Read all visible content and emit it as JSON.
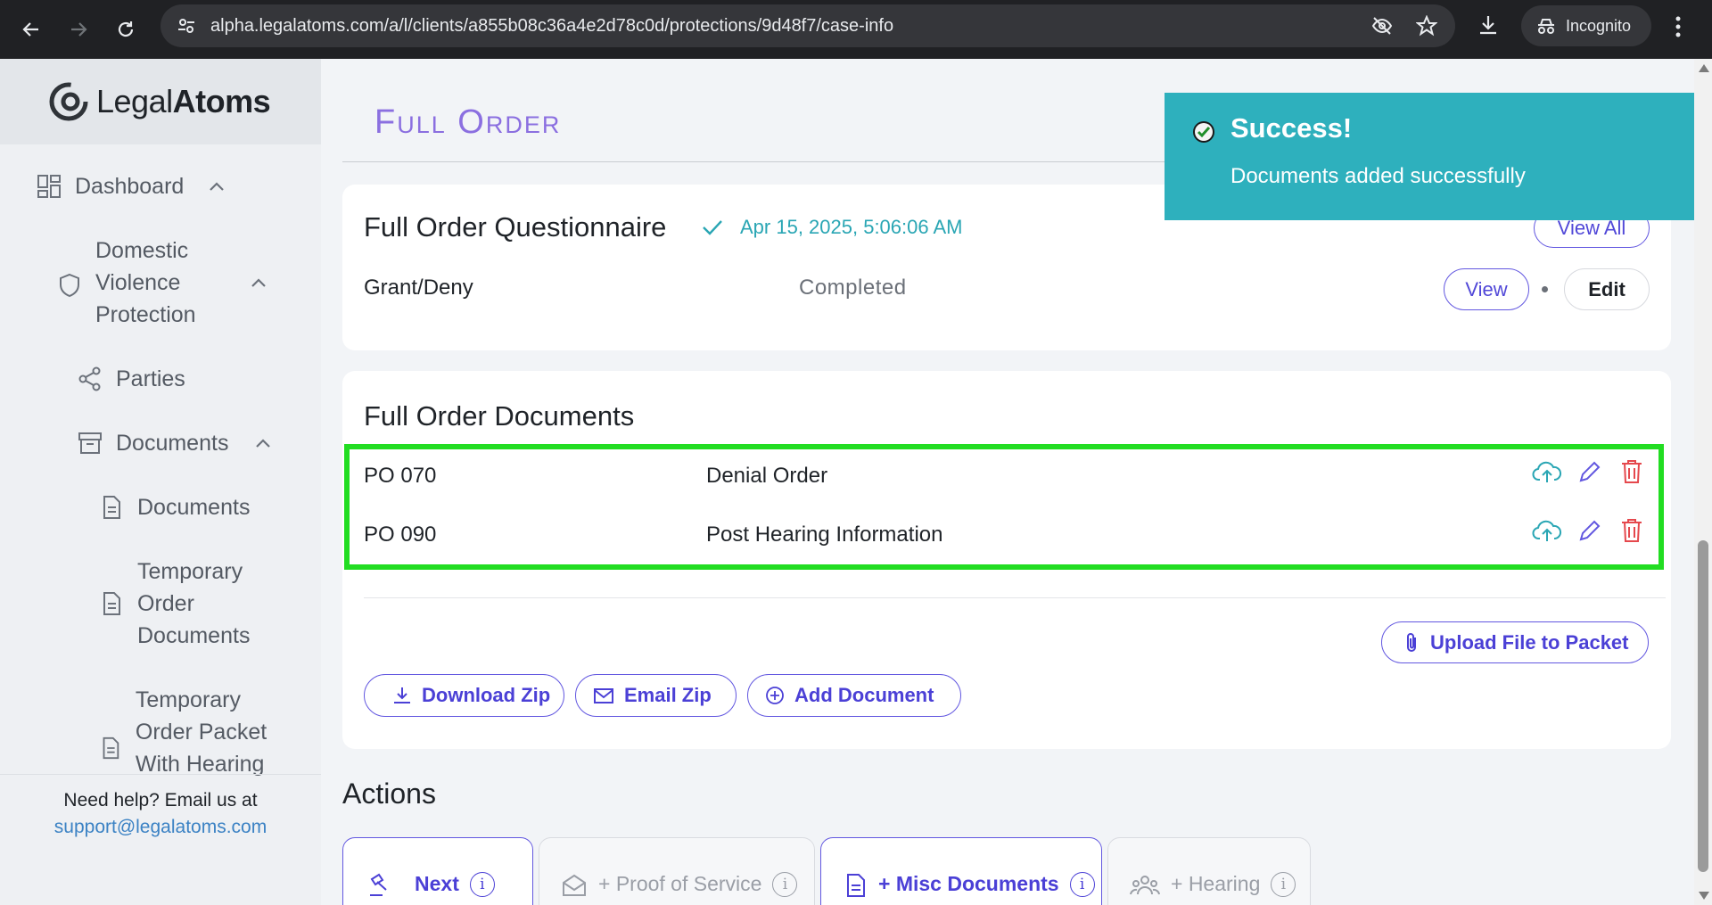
{
  "browser": {
    "url": "alpha.legalatoms.com/a/l/clients/a855b08c36a4e2d78c0d/protections/9d48f7/case-info",
    "incognito_label": "Incognito"
  },
  "sidebar": {
    "logo_part1": "Legal",
    "logo_part2": "Atoms",
    "items": [
      {
        "label": "Dashboard"
      },
      {
        "label": "Domestic Violence Protection"
      },
      {
        "label": "Parties"
      },
      {
        "label": "Documents"
      },
      {
        "label": "Documents"
      },
      {
        "label": "Temporary Order Documents"
      },
      {
        "label": "Temporary Order Packet With Hearing"
      }
    ],
    "help_text": "Need help? Email us at",
    "help_email": "support@legalatoms.com"
  },
  "main": {
    "page_title": "Full Order",
    "questionnaire": {
      "title": "Full Order Questionnaire",
      "date": "Apr 15, 2025, 5:06:06 AM",
      "view_all_label": "View All",
      "row_name": "Grant/Deny",
      "row_status": "Completed",
      "view_label": "View",
      "edit_label": "Edit"
    },
    "documents": {
      "title": "Full Order Documents",
      "rows": [
        {
          "code": "PO 070",
          "name": "Denial Order"
        },
        {
          "code": "PO 090",
          "name": "Post Hearing Information"
        }
      ],
      "upload_label": "Upload File to Packet",
      "download_zip_label": "Download Zip",
      "email_zip_label": "Email Zip",
      "add_document_label": "Add Document"
    },
    "actions": {
      "title": "Actions",
      "tiles": [
        {
          "label": "Next"
        },
        {
          "label": "+ Proof of Service"
        },
        {
          "label": "+ Misc Documents"
        },
        {
          "label": "+ Hearing"
        }
      ]
    }
  },
  "toast": {
    "title": "Success!",
    "message": "Documents added successfully",
    "color": "#2eb0bd"
  },
  "colors": {
    "accent": "#6257e0",
    "highlight": "#22dd22",
    "teal": "#2aa6b4",
    "danger": "#e5484d"
  }
}
